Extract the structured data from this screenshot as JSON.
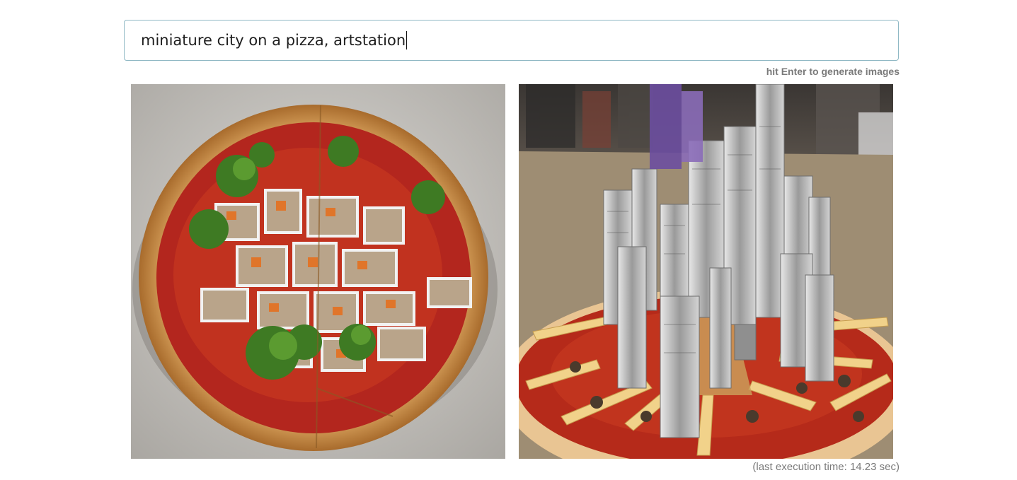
{
  "prompt": {
    "value": "miniature city on a pizza, artstation"
  },
  "hint": "hit Enter to generate images",
  "execution_time": "(last execution time: 14.23 sec)",
  "images": [
    {
      "subject": "pizza with miniature city buildings and trees, top view"
    },
    {
      "subject": "pizza with miniature skyscraper city, perspective view"
    }
  ],
  "colors": {
    "input_border": "#8fb8c4",
    "hint_text": "#7a7a7a",
    "sauce": "#b3261e",
    "crust": "#e8c48a"
  }
}
